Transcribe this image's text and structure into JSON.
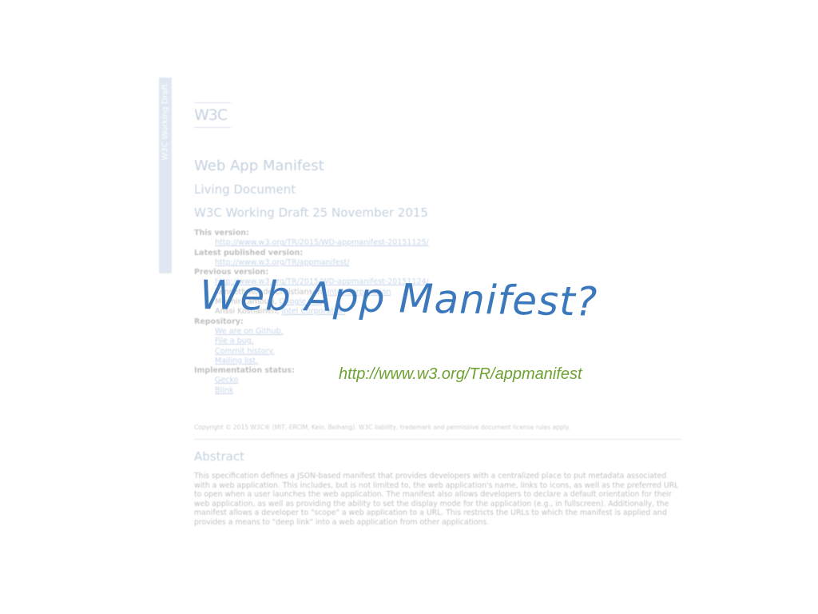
{
  "slide": {
    "title": "Web App Manifest?",
    "url": "http://www.w3.org/TR/appmanifest",
    "title_color": "#3b78bc",
    "url_color": "#6ea232"
  },
  "background_doc": {
    "side_label": "W3C Working Draft",
    "logo": "W3C",
    "heading": "Web App Manifest",
    "subheading": "Living Document",
    "status": "W3C Working Draft 25 November 2015",
    "this_version_label": "This version:",
    "this_version_url": "http://www.w3.org/TR/2015/WD-appmanifest-20151125/",
    "latest_label": "Latest published version:",
    "latest_url": "http://www.w3.org/TR/appmanifest/",
    "previous_label": "Previous version:",
    "previous_url": "http://www.w3.org/TR/2015/WD-appmanifest-20151124/",
    "editor_1_name": "Kenneth Rohde Christiansen,",
    "editor_1_org": "Intel Corporation",
    "editor_2_name": "Mounir Lamouri,",
    "editor_2_org": "Google Inc.",
    "editor_3_name": "Anssi Kostiainen,",
    "editor_3_org": "Intel Corporation",
    "repository_label": "Repository:",
    "repo_links": [
      "We are on Github.",
      "File a bug.",
      "Commit history.",
      "Mailing list."
    ],
    "implementation_label": "Implementation status:",
    "impl_links": [
      "Gecko",
      "Blink"
    ],
    "copyright": "Copyright © 2015 W3C® (MIT, ERCIM, Keio, Beihang). W3C liability, trademark and permissive document license rules apply.",
    "abstract_heading": "Abstract",
    "abstract_text": "This specification defines a JSON-based manifest that provides developers with a centralized place to put metadata associated with a web application. This includes, but is not limited to, the web application's name, links to icons, as well as the preferred URL to open when a user launches the web application. The manifest also allows developers to declare a default orientation for their web application, as well as providing the ability to set the display mode for the application (e.g., in fullscreen). Additionally, the manifest allows a developer to \"scope\" a web application to a URL. This restricts the URLs to which the manifest is applied and provides a means to \"deep link\" into a web application from other applications."
  }
}
